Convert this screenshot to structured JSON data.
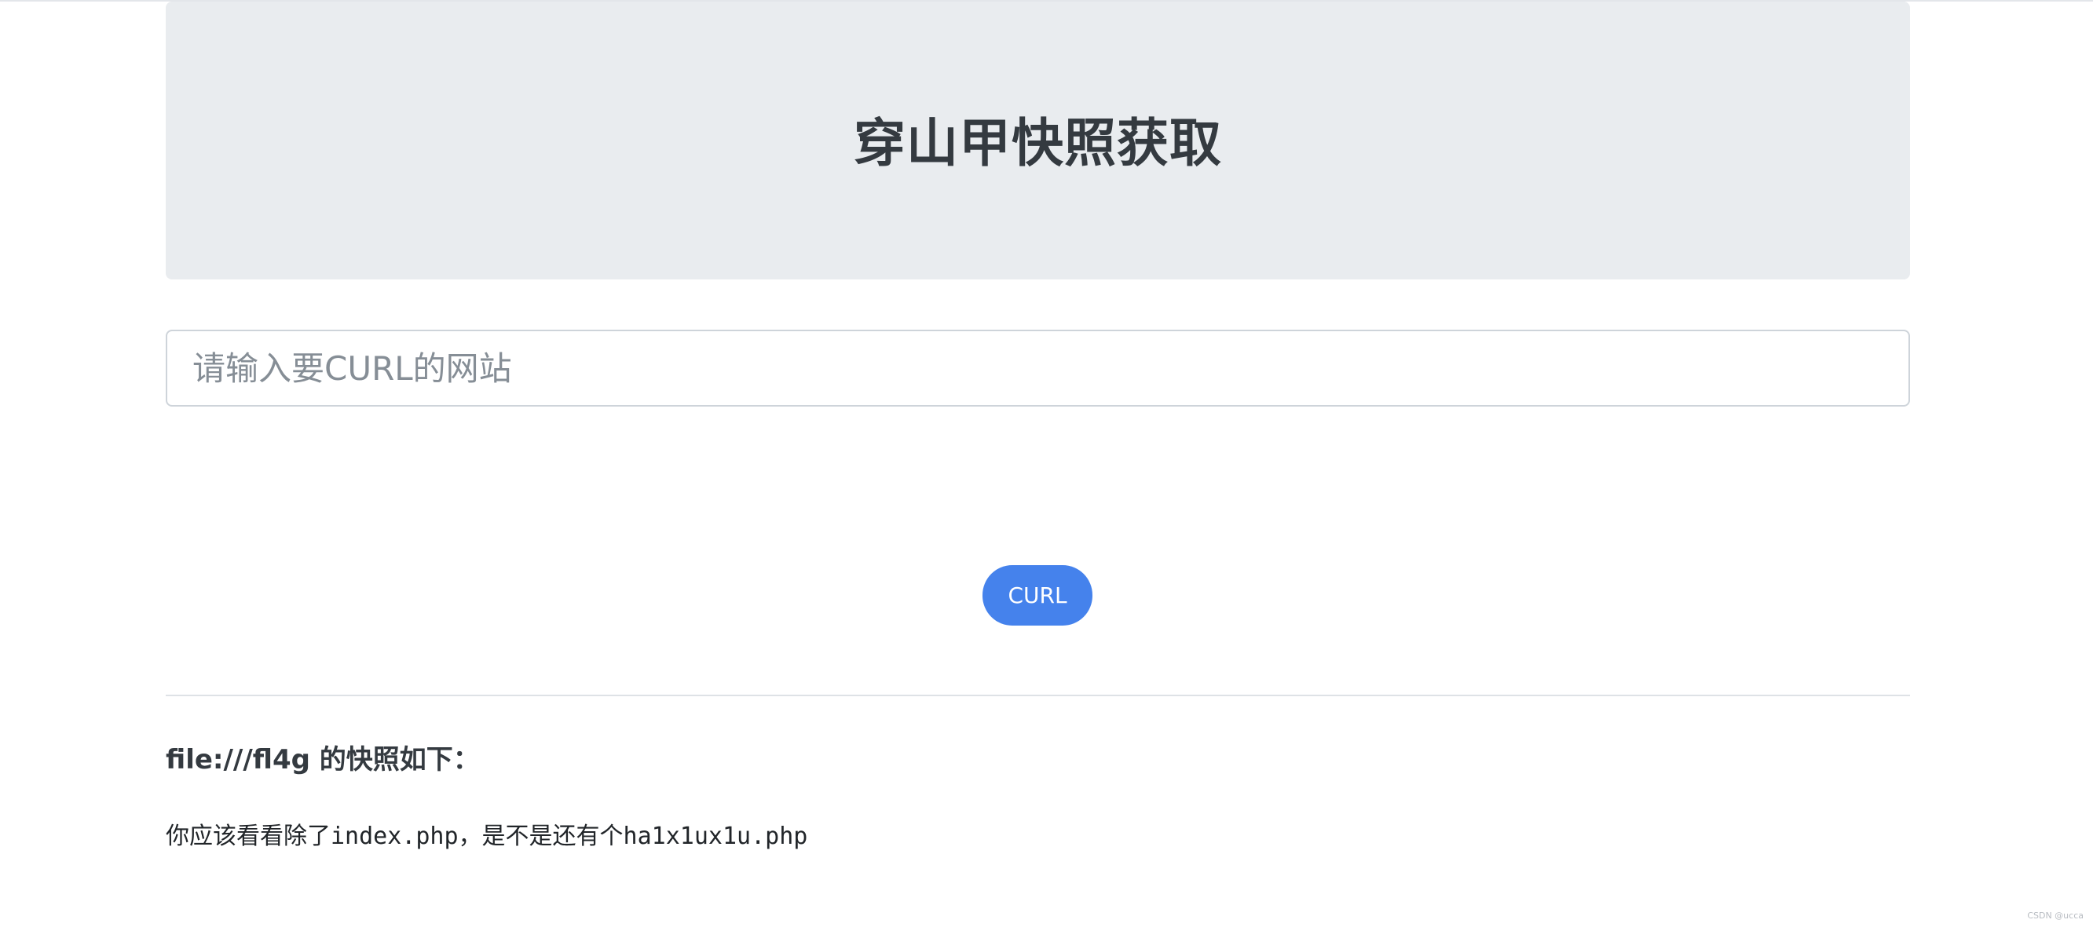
{
  "header": {
    "title": "穿山甲快照获取"
  },
  "form": {
    "url_placeholder": "请输入要CURL的网站",
    "url_value": "",
    "submit_label": "CURL"
  },
  "result": {
    "title": "file:///fl4g 的快照如下：",
    "body": "你应该看看除了index.php，是不是还有个ha1x1ux1u.php"
  },
  "footer": {
    "watermark": "CSDN @ucca"
  },
  "colors": {
    "jumbotron_bg": "#e9ecef",
    "button_bg": "#4582ec",
    "title_text": "#343a40"
  }
}
